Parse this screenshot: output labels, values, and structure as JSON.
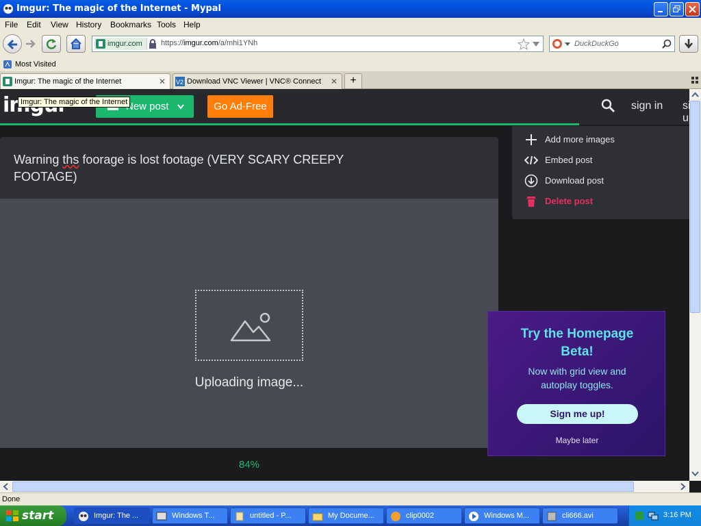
{
  "window": {
    "title": "Imgur: The magic of the Internet - Mypal"
  },
  "menu": [
    "File",
    "Edit",
    "View",
    "History",
    "Bookmarks",
    "Tools",
    "Help"
  ],
  "navigation": {
    "site_badge": "imgur.com",
    "url_prefix": "https://",
    "url_domain": "imgur.com",
    "url_path": "/a/mhi1YNh",
    "search_placeholder": "DuckDuckGo"
  },
  "bookmarks": {
    "most_visited": "Most Visited"
  },
  "tabs": [
    {
      "label": "Imgur: The magic of the Internet",
      "active": true
    },
    {
      "label": "Download VNC Viewer | VNC® Connect",
      "active": false
    }
  ],
  "tooltip": "Imgur: The magic of the Internet",
  "imgur": {
    "logo": "imgur",
    "new_post": "New post",
    "ad_free": "Go Ad-Free",
    "sign_in": "sign in",
    "sign_up": "sign up",
    "post_title_a": "Warning ",
    "post_title_sq": "ths",
    "post_title_b": " foorage is lost footage (VERY SCARY CREEPY FOOTAGE)",
    "uploading": "Uploading image...",
    "percent": "84%",
    "upload_progress": 0.84
  },
  "options": [
    {
      "label": "Add more images",
      "icon": "plus-icon"
    },
    {
      "label": "Embed post",
      "icon": "code-icon"
    },
    {
      "label": "Download post",
      "icon": "download-icon"
    },
    {
      "label": "Delete post",
      "icon": "trash-icon"
    }
  ],
  "promo": {
    "title": "Try the Homepage Beta!",
    "subtitle": "Now with grid view and autoplay toggles.",
    "button": "Sign me up!",
    "later": "Maybe later"
  },
  "status": "Done",
  "taskbar": {
    "start": "start",
    "tasks": [
      "Imgur: The ...",
      "Windows T...",
      "untitled - P...",
      "My Docume...",
      "clip0002",
      "Windows M...",
      "cli666.avi"
    ],
    "clock": "3:16 PM"
  },
  "colors": {
    "accent": "#1bb76e",
    "ad_free": "#ff7e0a",
    "delete": "#e82e61",
    "promo_title": "#5ee2e8"
  }
}
